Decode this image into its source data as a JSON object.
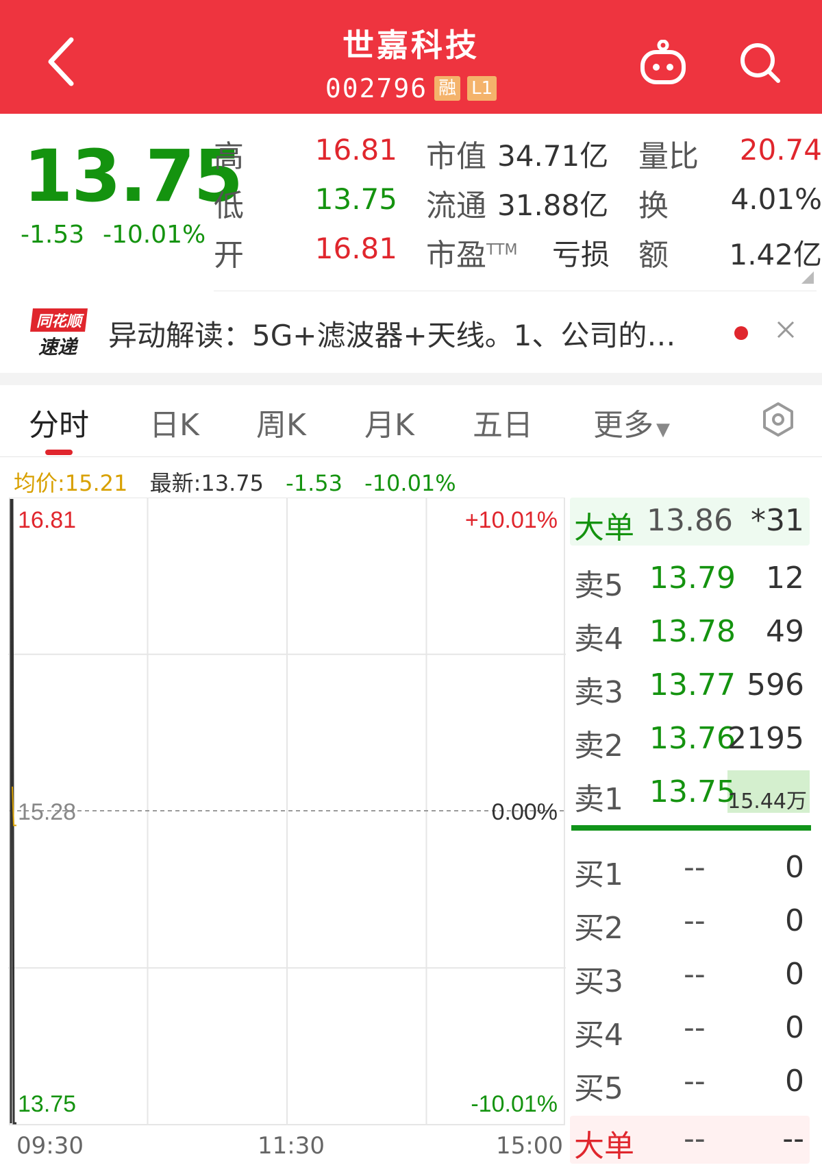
{
  "header": {
    "title": "世嘉科技",
    "code": "002796",
    "tag_margin": "融",
    "tag_level": "L1",
    "back_icon": "chevron-left-icon",
    "robot_icon": "robot-icon",
    "search_icon": "search-icon"
  },
  "quote": {
    "price": "13.75",
    "change": "-1.53",
    "change_pct": "-10.01%",
    "high_label": "高",
    "high": "16.81",
    "low_label": "低",
    "low": "13.75",
    "open_label": "开",
    "open": "16.81",
    "mktcap_label": "市值",
    "mktcap": "34.71亿",
    "float_label": "流通",
    "float": "31.88亿",
    "pe_label": "市盈",
    "pe_sup": "TTM",
    "pe": "亏损",
    "volratio_label": "量比",
    "volratio": "20.74",
    "turnover_label": "换",
    "turnover": "4.01%",
    "amount_label": "额",
    "amount": "1.42亿"
  },
  "news": {
    "logo_top": "同花顺",
    "logo_bottom": "速递",
    "text": "异动解读：5G+滤波器+天线。1、公司的…"
  },
  "tabs": [
    {
      "label": "分时"
    },
    {
      "label": "日K"
    },
    {
      "label": "周K"
    },
    {
      "label": "月K"
    },
    {
      "label": "五日"
    },
    {
      "label": "更多"
    }
  ],
  "info": {
    "avg": "均价:15.21",
    "latest": "最新:13.75",
    "change": "-1.53",
    "change_pct": "-10.01%"
  },
  "chart_data": {
    "type": "line",
    "y_top": "16.81",
    "y_mid": "15.28",
    "y_bottom": "13.75",
    "pct_top": "+10.01%",
    "pct_mid": "0.00%",
    "pct_bottom": "-10.01%",
    "x_ticks": [
      "09:30",
      "11:30",
      "15:00"
    ],
    "ylim": [
      13.75,
      16.81
    ],
    "series": [
      {
        "values": [
          16.81,
          13.75,
          13.75
        ]
      },
      {
        "values": [
          15.4,
          15.21,
          15.21
        ]
      }
    ],
    "colors": {
      "price": "#333333",
      "average": "#d8a000",
      "grid": "#e6e6e6"
    }
  },
  "order_book": {
    "big_top": {
      "label": "大单",
      "price": "13.86",
      "vol": "*31"
    },
    "sell": [
      {
        "label": "卖5",
        "price": "13.79",
        "vol": "12"
      },
      {
        "label": "卖4",
        "price": "13.78",
        "vol": "49"
      },
      {
        "label": "卖3",
        "price": "13.77",
        "vol": "596"
      },
      {
        "label": "卖2",
        "price": "13.76",
        "vol": "2195"
      },
      {
        "label": "卖1",
        "price": "13.75",
        "vol": "15.44万"
      }
    ],
    "buy": [
      {
        "label": "买1",
        "price": "--",
        "vol": "0"
      },
      {
        "label": "买2",
        "price": "--",
        "vol": "0"
      },
      {
        "label": "买3",
        "price": "--",
        "vol": "0"
      },
      {
        "label": "买4",
        "price": "--",
        "vol": "0"
      },
      {
        "label": "买5",
        "price": "--",
        "vol": "0"
      }
    ],
    "big_bottom": {
      "label": "大单",
      "price": "--",
      "vol": "--"
    }
  },
  "colors": {
    "header": "#ee343f",
    "up": "#e0262d",
    "down": "#14930f",
    "avg": "#d8a000"
  }
}
